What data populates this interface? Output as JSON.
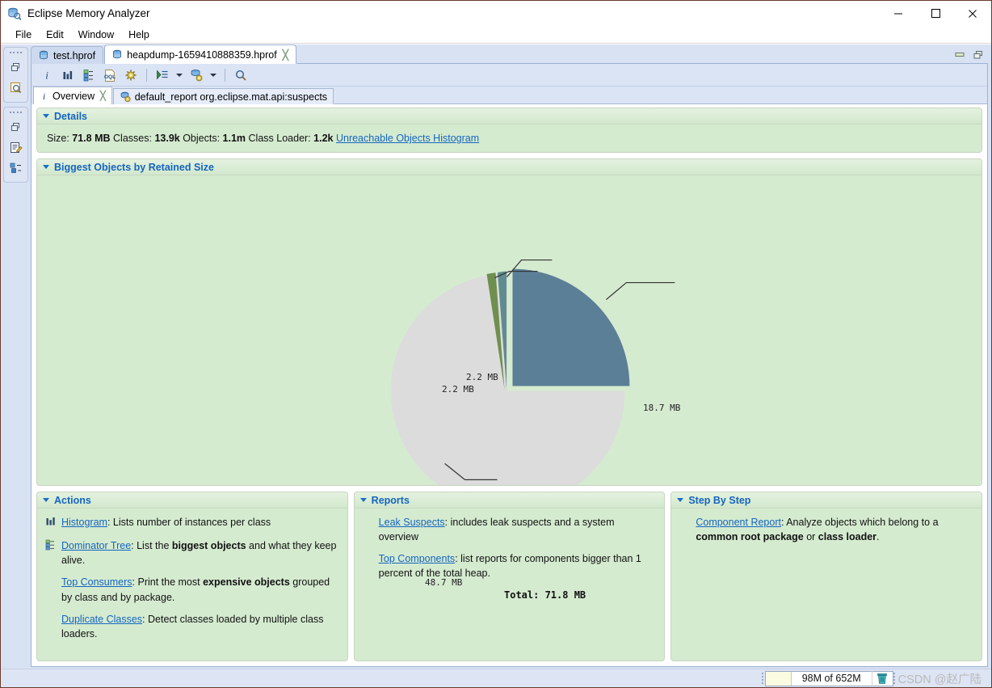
{
  "window": {
    "title": "Eclipse Memory Analyzer",
    "app_icon": "memory-analyzer-icon",
    "minimize": "–",
    "maximize": "",
    "close": "✕"
  },
  "menubar": {
    "items": [
      {
        "label": "File"
      },
      {
        "label": "Edit"
      },
      {
        "label": "Window"
      },
      {
        "label": "Help"
      }
    ]
  },
  "trim": {
    "groups": [
      {
        "buttons": [
          {
            "icon": "restore-icon",
            "label": "Restore"
          },
          {
            "icon": "heap-dump-history-icon",
            "label": "Heap Dump History"
          }
        ]
      },
      {
        "buttons": [
          {
            "icon": "restore-icon",
            "label": "Restore"
          },
          {
            "icon": "notes-icon",
            "label": "Notes"
          },
          {
            "icon": "inspector-icon",
            "label": "Inspector"
          }
        ]
      }
    ]
  },
  "editor_tabs": {
    "tabs": [
      {
        "label": "test.hprof",
        "icon": "heap-dump-icon",
        "active": false,
        "closable": false
      },
      {
        "label": "heapdump-1659410888359.hprof",
        "icon": "heap-dump-icon",
        "active": true,
        "closable": true,
        "close_glyph": "╳"
      }
    ],
    "controls": [
      {
        "icon": "minimize-editor-icon"
      },
      {
        "icon": "maximize-editor-icon"
      }
    ]
  },
  "view_toolbar": {
    "buttons": [
      {
        "icon": "overview-info-icon",
        "label": "Overview"
      },
      {
        "icon": "histogram-icon",
        "label": "Histogram"
      },
      {
        "icon": "dominator-tree-icon",
        "label": "Dominator Tree"
      },
      {
        "icon": "oql-icon",
        "label": "OQL Studio"
      },
      {
        "icon": "calculate-retained-size-icon",
        "label": "Calculate Retained Size"
      },
      {
        "icon": "run-expert-system-icon",
        "label": "Run Expert System Test",
        "has_dropdown": true
      },
      {
        "icon": "query-browser-icon",
        "label": "Query Browser",
        "has_dropdown": true
      },
      {
        "icon": "search-icon",
        "label": "Find"
      }
    ]
  },
  "inner_tabs": {
    "tabs": [
      {
        "label": "Overview",
        "icon": "info-icon",
        "active": true,
        "closable": true,
        "close_glyph": "╳"
      },
      {
        "label": "default_report  org.eclipse.mat.api:suspects",
        "icon": "report-icon",
        "active": false,
        "closable": false
      }
    ]
  },
  "details": {
    "title": "Details",
    "size_label": "Size:",
    "size_value": "71.8 MB",
    "classes_label": "Classes:",
    "classes_value": "13.9k",
    "objects_label": "Objects:",
    "objects_value": "1.1m",
    "classloader_label": "Class Loader:",
    "classloader_value": "1.2k",
    "unreachable_link": "Unreachable Objects Histogram"
  },
  "biggest_objects": {
    "title": "Biggest Objects by Retained Size"
  },
  "chart_data": {
    "type": "pie",
    "title": "Biggest Objects by Retained Size",
    "total_label": "Total: 71.8 MB",
    "total_value": 71.8,
    "unit": "MB",
    "labels": [
      "18.7 MB",
      "2.2 MB",
      "2.2 MB",
      "48.7 MB"
    ],
    "values": [
      18.7,
      2.2,
      2.2,
      48.7
    ],
    "colors": [
      "#5b7f96",
      "#5f8c8f",
      "#6f8f4f",
      "#dcdcdc"
    ],
    "legend": "none",
    "exploded": [
      true,
      true,
      true,
      false
    ]
  },
  "actions": {
    "title": "Actions",
    "items": [
      {
        "icon": "histogram-icon",
        "link": "Histogram",
        "text_before": "",
        "segments": [
          {
            "t": ": Lists number of instances per class",
            "b": false
          }
        ]
      },
      {
        "icon": "dominator-tree-icon",
        "link": "Dominator Tree",
        "segments": [
          {
            "t": ": List the ",
            "b": false
          },
          {
            "t": "biggest objects",
            "b": true
          },
          {
            "t": " and what they keep alive.",
            "b": false
          }
        ]
      },
      {
        "icon": "",
        "link": "Top Consumers",
        "segments": [
          {
            "t": ": Print the most ",
            "b": false
          },
          {
            "t": "expensive objects",
            "b": true
          },
          {
            "t": " grouped by class and by package.",
            "b": false
          }
        ]
      },
      {
        "icon": "",
        "link": "Duplicate Classes",
        "segments": [
          {
            "t": ": Detect classes loaded by multiple class loaders.",
            "b": false
          }
        ]
      }
    ]
  },
  "reports": {
    "title": "Reports",
    "items": [
      {
        "icon": "",
        "link": "Leak Suspects",
        "segments": [
          {
            "t": ": includes leak suspects and a system overview",
            "b": false
          }
        ]
      },
      {
        "icon": "",
        "link": "Top Components",
        "segments": [
          {
            "t": ": list reports for components bigger than 1 percent of the total heap.",
            "b": false
          }
        ]
      }
    ]
  },
  "step_by_step": {
    "title": "Step By Step",
    "items": [
      {
        "icon": "",
        "link": "Component Report",
        "segments": [
          {
            "t": ": Analyze objects which belong to a ",
            "b": false
          },
          {
            "t": "common root package",
            "b": true
          },
          {
            "t": " or ",
            "b": false
          },
          {
            "t": "class loader",
            "b": true
          },
          {
            "t": ".",
            "b": false
          }
        ]
      }
    ]
  },
  "statusbar": {
    "heap_text": "98M of 652M",
    "trash_icon": "trash-icon",
    "watermark": "CSDN @赵广陆"
  },
  "colors": {
    "section_bg": "#d5ebd0",
    "link": "#1565c0",
    "slice_blue": "#5b7f96",
    "slice_teal": "#5f8c8f",
    "slice_green": "#6f8f4f",
    "slice_gray": "#dcdcdc"
  }
}
